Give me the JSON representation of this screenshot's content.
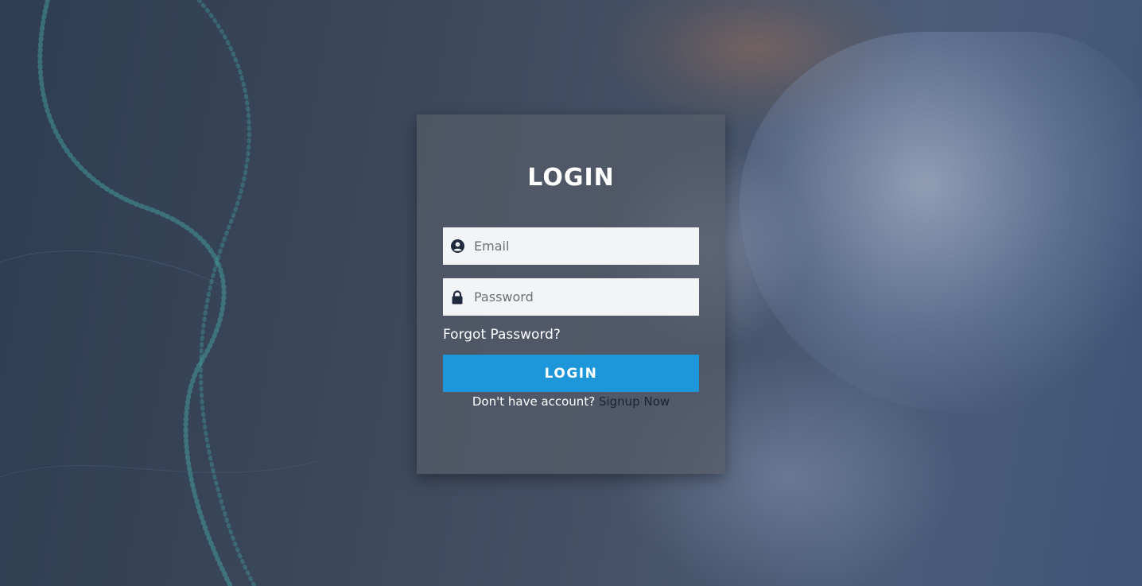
{
  "form": {
    "title": "LOGIN",
    "email_placeholder": "Email",
    "password_placeholder": "Password",
    "forgot_label": "Forgot Password?",
    "login_button": "LOGIN",
    "no_account_text": "Don't have account?",
    "signup_link": "Signup Now"
  },
  "icons": {
    "email": "user-circle-icon",
    "password": "lock-icon"
  },
  "colors": {
    "primary_button": "#1e96da",
    "card_overlay": "#565c68",
    "signup_link": "#1c2333"
  }
}
